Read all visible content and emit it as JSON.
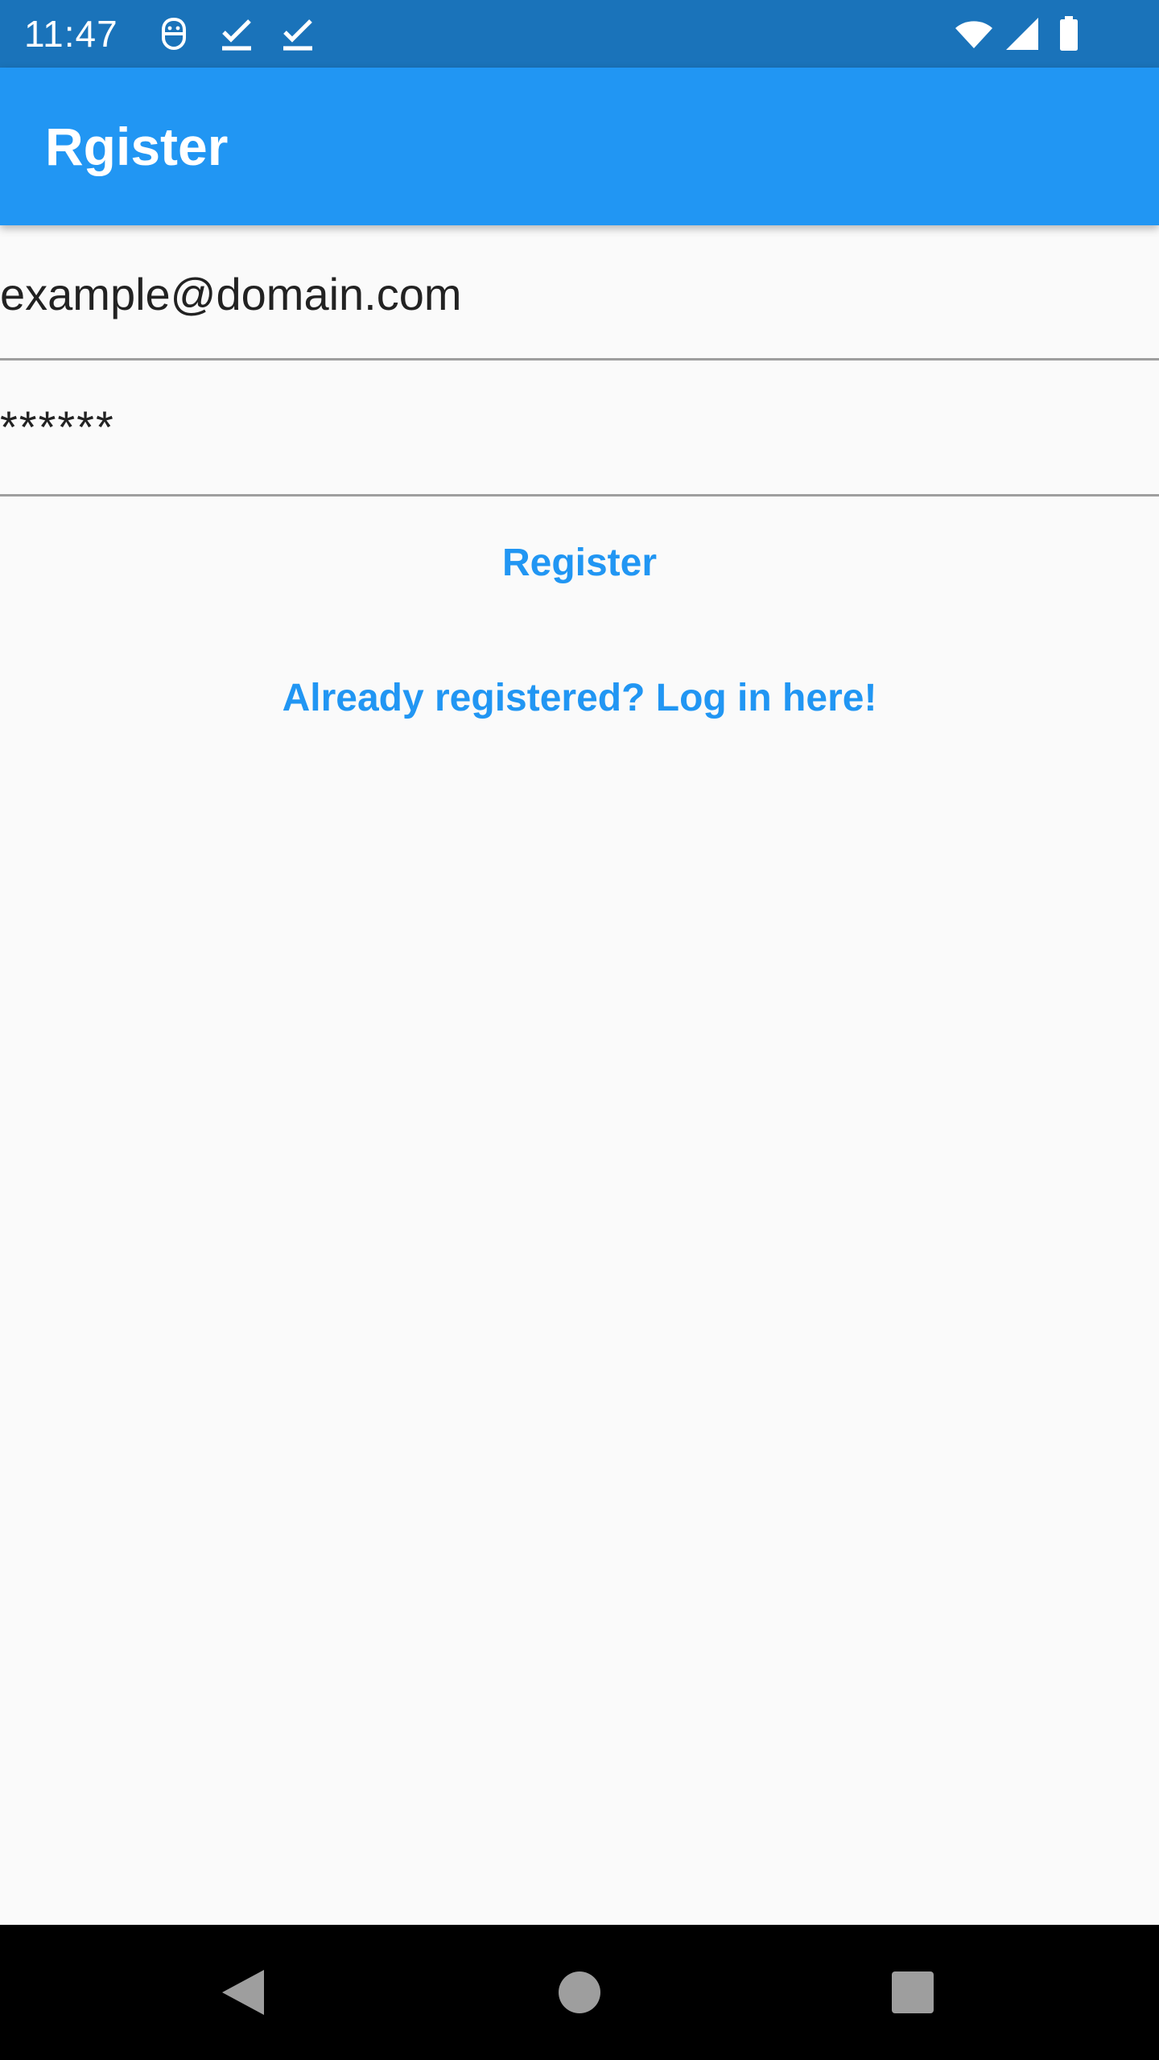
{
  "status_bar": {
    "time": "11:47",
    "background": "#1a73ba",
    "left_icons": [
      "face-icon",
      "checkmark-icon",
      "checkmark-icon"
    ],
    "right_icons": [
      "wifi-icon",
      "signal-icon",
      "battery-icon"
    ]
  },
  "app_bar": {
    "title": "Rgister",
    "background": "#2196f3"
  },
  "form": {
    "email_value": "example@domain.com",
    "password_value": "******"
  },
  "actions": {
    "register_label": "Register",
    "login_link_label": "Already registered? Log in here!",
    "accent": "#2196f3"
  },
  "nav_bar": {
    "buttons": [
      "back-icon",
      "home-icon",
      "recents-icon"
    ]
  }
}
